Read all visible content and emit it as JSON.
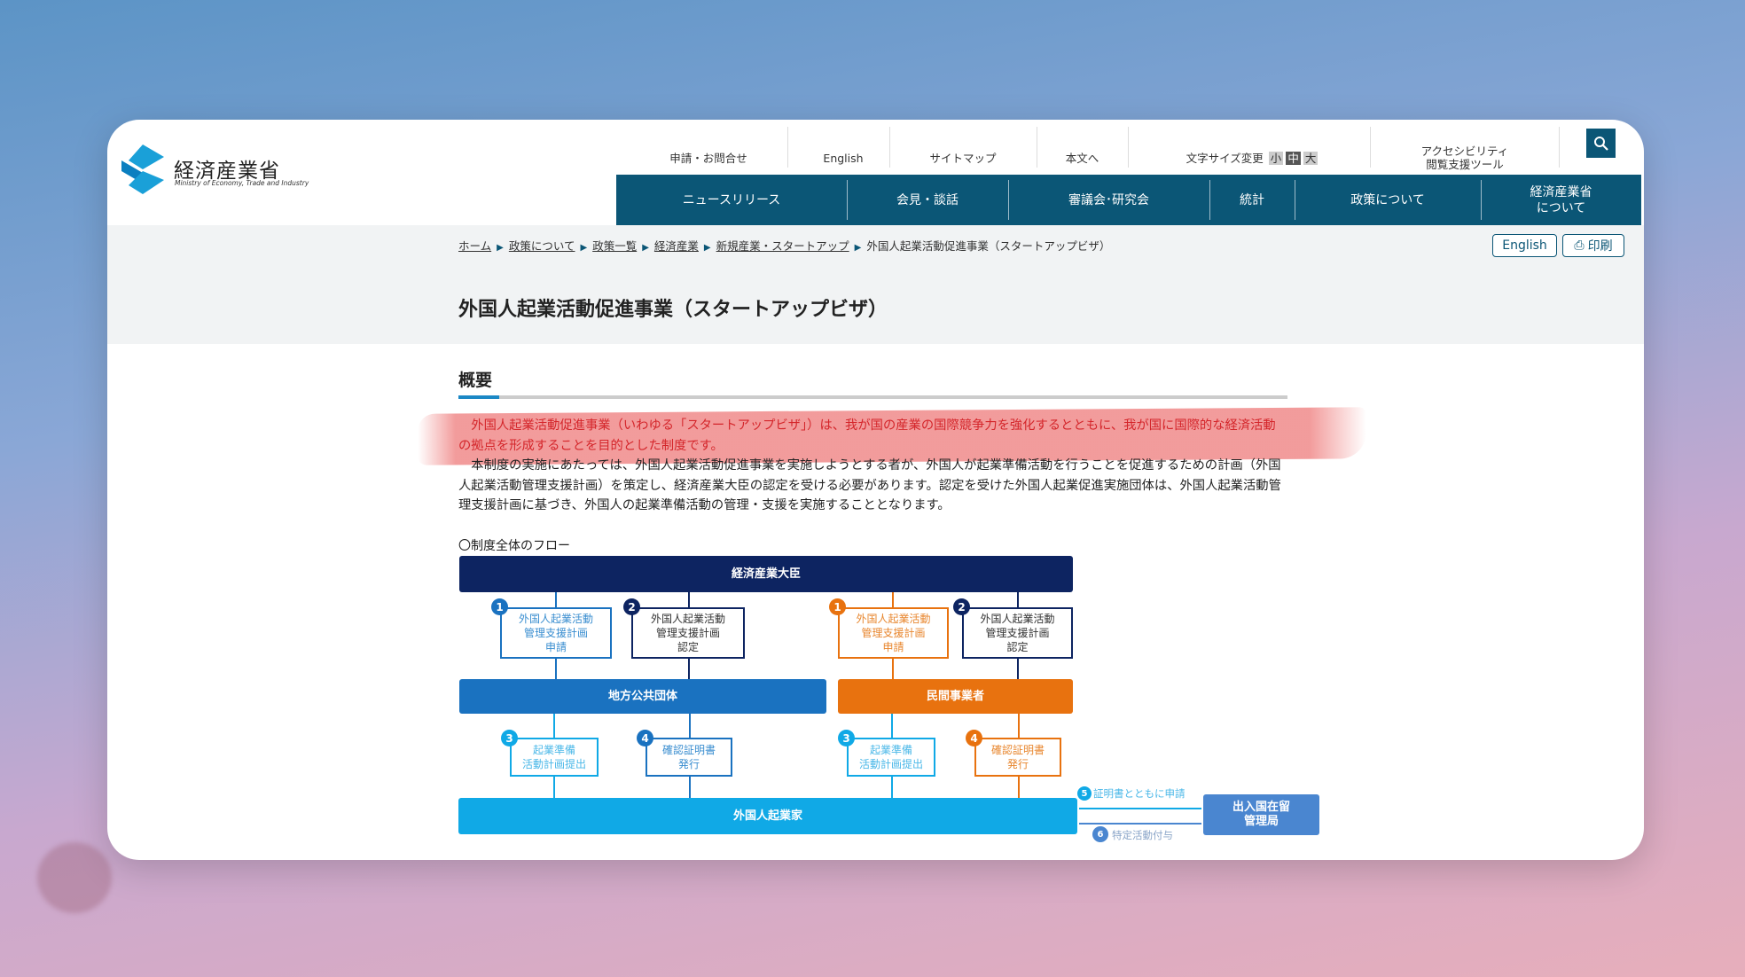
{
  "logo": {
    "name_ja": "経済産業省",
    "name_en": "Ministry of Economy, Trade and Industry"
  },
  "utility": {
    "contact": "申請・お問合せ",
    "english": "English",
    "sitemap": "サイトマップ",
    "main_text": "本文へ",
    "font_size_label": "文字サイズ変更",
    "font_small": "小",
    "font_medium": "中",
    "font_large": "大",
    "accessibility_line1": "アクセシビリティ",
    "accessibility_line2": "閲覧支援ツール",
    "search_icon": "search-icon"
  },
  "nav": {
    "items": [
      "ニュースリリース",
      "会見・談話",
      "審議会･研究会",
      "統計",
      "政策について"
    ],
    "about_line1": "経済産業省",
    "about_line2": "について"
  },
  "breadcrumb": {
    "items": [
      "ホーム",
      "政策について",
      "政策一覧",
      "経済産業",
      "新規産業・スタートアップ"
    ],
    "current": "外国人起業活動促進事業（スタートアップビザ）"
  },
  "buttons": {
    "english": "English",
    "print": "印刷"
  },
  "page_title": "外国人起業活動促進事業（スタートアップビザ）",
  "section": {
    "heading": "概要",
    "highlight": "　外国人起業活動促進事業（いわゆる「スタートアップビザ」）は、我が国の産業の国際競争力を強化するとともに、我が国に国際的な経済活動の拠点を形成することを目的とした制度です。",
    "body": "　本制度の実施にあたっては、外国人起業活動促進事業を実施しようとする者が、外国人が起業準備活動を行うことを促進するための計画（外国人起業活動管理支援計画）を策定し、経済産業大臣の認定を受ける必要があります。認定を受けた外国人起業促進実施団体は、外国人起業活動管理支援計画に基づき、外国人の起業準備活動の管理・支援を実施することとなります。",
    "flow_label": "〇制度全体のフロー"
  },
  "diagram": {
    "minister": "経済産業大臣",
    "local_gov": "地方公共団体",
    "private": "民間事業者",
    "entrepreneur": "外国人起業家",
    "immigration": "出入国在留\n管理局",
    "step1": "外国人起業活動\n管理支援計画\n申請",
    "step2": "外国人起業活動\n管理支援計画\n認定",
    "step3": "起業準備\n活動計画提出",
    "step4": "確認証明書\n発行",
    "step5": "証明書とともに申請",
    "step6": "特定活動付与",
    "nums": [
      "1",
      "2",
      "3",
      "4",
      "5",
      "6"
    ],
    "colors": {
      "navy": "#0d2461",
      "blue": "#1a72c0",
      "orange": "#e8720f",
      "cyan": "#10a9e6",
      "immigration": "#4a86d0"
    }
  },
  "colors": {
    "nav": "#0b5676",
    "highlight": "#f08a8a",
    "highlight_text": "#d4262b"
  }
}
